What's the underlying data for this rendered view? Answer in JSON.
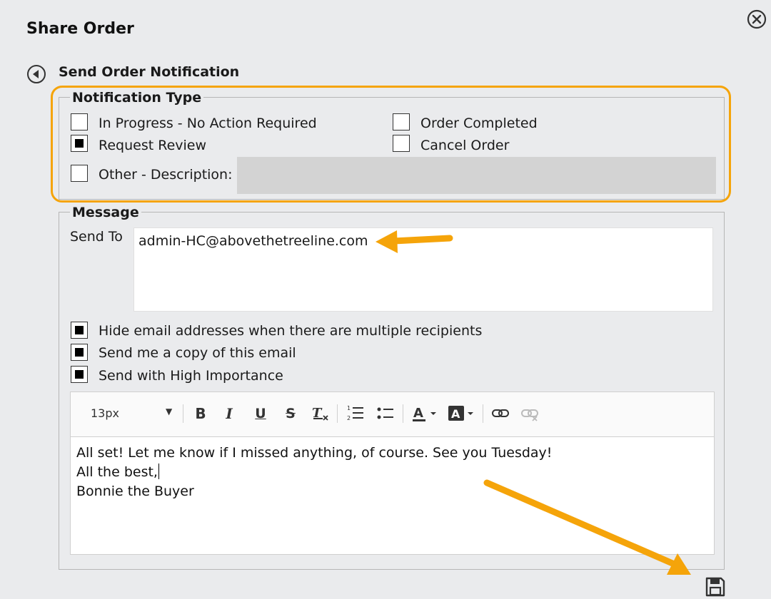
{
  "dialog": {
    "title": "Share Order"
  },
  "section": {
    "title": "Send Order Notification"
  },
  "notification_type": {
    "legend": "Notification Type",
    "options": [
      {
        "label": "In Progress - No Action Required",
        "checked": false
      },
      {
        "label": "Order Completed",
        "checked": false
      },
      {
        "label": "Request Review",
        "checked": true
      },
      {
        "label": "Cancel Order",
        "checked": false
      },
      {
        "label": "Other - Description:",
        "checked": false
      }
    ],
    "other_description_value": ""
  },
  "message": {
    "legend": "Message",
    "send_to_label": "Send To",
    "send_to_value": "admin-HC@abovethetreeline.com",
    "options": [
      {
        "label": "Hide email addresses when there are multiple recipients",
        "checked": true
      },
      {
        "label": "Send me a copy of this email",
        "checked": true
      },
      {
        "label": "Send with High Importance",
        "checked": true
      }
    ],
    "editor": {
      "font_size": "13px",
      "toolbar_icons": [
        "bold-icon",
        "italic-icon",
        "underline-icon",
        "strikethrough-icon",
        "clear-formatting-icon",
        "ordered-list-icon",
        "bullet-list-icon",
        "font-color-icon",
        "highlight-color-icon",
        "link-icon",
        "unlink-icon"
      ],
      "body_lines": [
        "All set! Let me know if I missed anything, of course. See you Tuesday!",
        "All the best,",
        "Bonnie the Buyer"
      ]
    }
  },
  "annotation_color": "#f5a40a"
}
